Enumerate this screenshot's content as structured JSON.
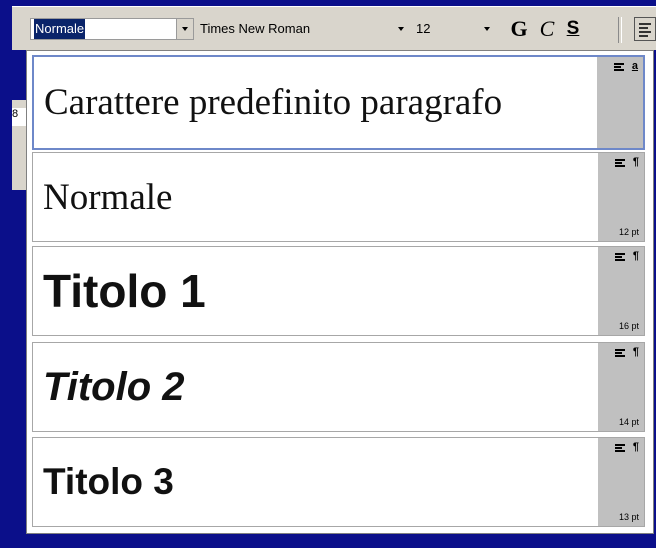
{
  "toolbar": {
    "style_combo": "Normale",
    "font_combo": "Times New Roman",
    "size_combo": "12",
    "bold_label": "G",
    "italic_label": "C",
    "underline_label": "S"
  },
  "background_text": "8",
  "style_list": [
    {
      "label": "Carattere predefinito paragrafo",
      "marker": "a",
      "size": ""
    },
    {
      "label": "Normale",
      "marker": "¶",
      "size": "12 pt"
    },
    {
      "label": "Titolo 1",
      "marker": "¶",
      "size": "16 pt"
    },
    {
      "label": "Titolo 2",
      "marker": "¶",
      "size": "14 pt"
    },
    {
      "label": "Titolo 3",
      "marker": "¶",
      "size": "13 pt"
    }
  ],
  "colors": {
    "background": "#0b0f8a",
    "toolbar": "#d9d5cc",
    "selection": "#0a246a",
    "active_border": "#6e88c9"
  }
}
